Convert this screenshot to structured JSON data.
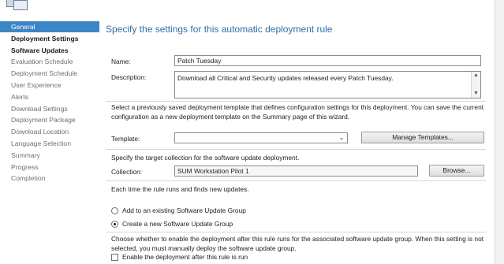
{
  "nav": {
    "items": [
      {
        "label": "General",
        "state": "selected"
      },
      {
        "label": "Deployment Settings",
        "state": "bold"
      },
      {
        "label": "Software Updates",
        "state": "bold"
      },
      {
        "label": "Evaluation Schedule",
        "state": "normal"
      },
      {
        "label": "Deployment Schedule",
        "state": "normal"
      },
      {
        "label": "User Experience",
        "state": "normal"
      },
      {
        "label": "Alerts",
        "state": "normal"
      },
      {
        "label": "Download Settings",
        "state": "normal"
      },
      {
        "label": "Deployment Package",
        "state": "normal"
      },
      {
        "label": "Download Location",
        "state": "normal"
      },
      {
        "label": "Language Selection",
        "state": "normal"
      },
      {
        "label": "Summary",
        "state": "normal"
      },
      {
        "label": "Progress",
        "state": "normal"
      },
      {
        "label": "Completion",
        "state": "normal"
      }
    ]
  },
  "main": {
    "heading": "Specify the settings for this automatic deployment rule",
    "name_label": "Name:",
    "name_value": "Patch Tuesday",
    "description_label": "Description:",
    "description_value": "Download all Critical and Security updates released every Patch Tuesday.",
    "template_text": "Select a previously saved deployment template that defines configuration settings for this deployment. You can save the current configuration as a new deployment template on the Summary page of this wizard.",
    "template_label": "Template:",
    "template_value": "",
    "manage_templates_button": "Manage Templates...",
    "collection_text": "Specify the target collection for the software update deployment.",
    "collection_label": "Collection:",
    "collection_value": "SUM Workstation Pilot 1",
    "browse_button": "Browse...",
    "rule_runs_text": "Each time the rule runs and finds new updates.",
    "radio_existing": "Add to an existing Software Update Group",
    "radio_new": "Create a new Software Update Group",
    "radio_selected": "new",
    "enable_text": "Choose whether to enable the deployment after this rule runs for the associated software update group. When this setting is not selected, you must manually deploy the software update group.",
    "enable_checkbox_label": "Enable the deployment after this rule is run",
    "enable_checked": false
  },
  "colors": {
    "accent": "#3d86c6",
    "heading": "#2e6fa8"
  }
}
